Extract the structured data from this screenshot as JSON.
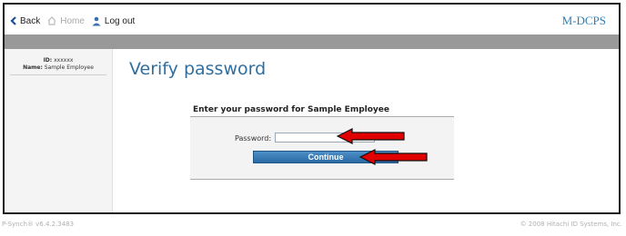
{
  "topnav": {
    "back_label": "Back",
    "home_label": "Home",
    "logout_label": "Log out"
  },
  "brand": "M-DCPS",
  "sidebar": {
    "id_label": "ID:",
    "id_value": "xxxxxx",
    "name_label": "Name:",
    "name_value": "Sample Employee"
  },
  "main": {
    "title": "Verify password",
    "prompt": "Enter your password for Sample Employee",
    "password_label": "Password:",
    "password_value": "",
    "continue_label": "Continue"
  },
  "footer": {
    "version": "P-Synch® v6.4.2.3483",
    "copyright": "© 2008 Hitachi ID Systems, Inc."
  },
  "colors": {
    "accent": "#2f6fa0",
    "button": "#2a6aa6",
    "annotation_arrow": "#e00000"
  },
  "icons": [
    "back-chevron-icon",
    "home-icon",
    "user-icon",
    "red-arrow-icon"
  ]
}
